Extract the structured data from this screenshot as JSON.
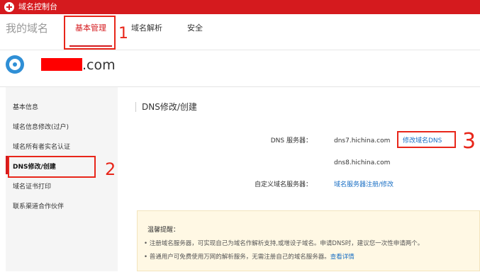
{
  "topbar": {
    "title": "域名控制台"
  },
  "header": {
    "my_domain": "我的域名"
  },
  "tabs": [
    {
      "label": "基本管理",
      "active": true
    },
    {
      "label": "域名解析",
      "active": false
    },
    {
      "label": "安全",
      "active": false
    }
  ],
  "domain": {
    "suffix": ".com"
  },
  "sidebar": {
    "items": [
      {
        "label": "基本信息"
      },
      {
        "label": "域名信息修改(过户)"
      },
      {
        "label": "域名所有者实名认证"
      },
      {
        "label": "DNS修改/创建",
        "active": true
      },
      {
        "label": "域名证书打印"
      },
      {
        "label": "联系渠道合作伙伴"
      }
    ]
  },
  "main": {
    "title": "DNS修改/创建",
    "dns_label": "DNS 服务器：",
    "dns1": "dns7.hichina.com",
    "dns2": "dns8.hichina.com",
    "modify_link": "修改域名DNS",
    "custom_label": "自定义域名服务器：",
    "custom_link": "域名服务器注册/修改"
  },
  "tips": {
    "title": "温馨提醒：",
    "line1": "• 注册域名服务器，可实现自己为域名作解析支持,或增设子域名。申请DNS时，建议您一次性申请两个。",
    "line2": "• 普通用户可免费使用万网的解析服务，无需注册自己的域名服务器。",
    "line2_link": "查看详情"
  },
  "annotations": {
    "n1": "1",
    "n2": "2",
    "n3": "3"
  },
  "colors": {
    "brand_red": "#d51a1e",
    "link_blue": "#1a6fc4",
    "annotation_red": "#e8261a"
  }
}
